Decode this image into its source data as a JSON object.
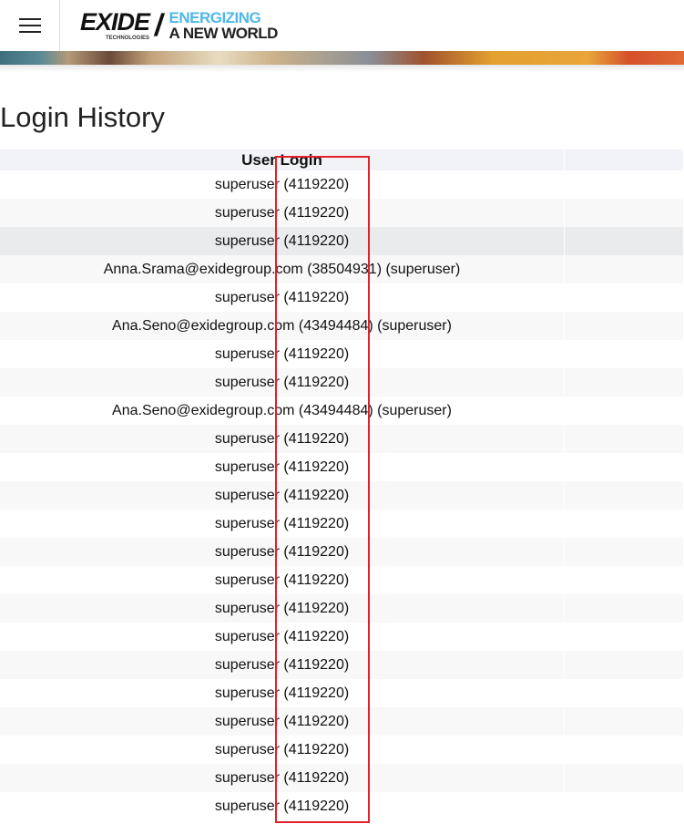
{
  "header": {
    "brand": "EXIDE",
    "brand_sub": "TECHNOLOGIES",
    "tagline_1": "ENERGIZING",
    "tagline_2": "A NEW WORLD"
  },
  "page_title": "Login History",
  "table": {
    "columns": [
      "User Login",
      ""
    ],
    "rows": [
      "superuser (4119220)",
      "superuser (4119220)",
      "superuser (4119220)",
      "Anna.Srama@exidegroup.com (38504931) (superuser)",
      "superuser (4119220)",
      "Ana.Seno@exidegroup.com (43494484) (superuser)",
      "superuser (4119220)",
      "superuser (4119220)",
      "Ana.Seno@exidegroup.com (43494484) (superuser)",
      "superuser (4119220)",
      "superuser (4119220)",
      "superuser (4119220)",
      "superuser (4119220)",
      "superuser (4119220)",
      "superuser (4119220)",
      "superuser (4119220)",
      "superuser (4119220)",
      "superuser (4119220)",
      "superuser (4119220)",
      "superuser (4119220)",
      "superuser (4119220)",
      "superuser (4119220)",
      "superuser (4119220)"
    ]
  },
  "colors": {
    "highlight_box": "#e0202a",
    "tagline_accent": "#4fb8e6"
  }
}
